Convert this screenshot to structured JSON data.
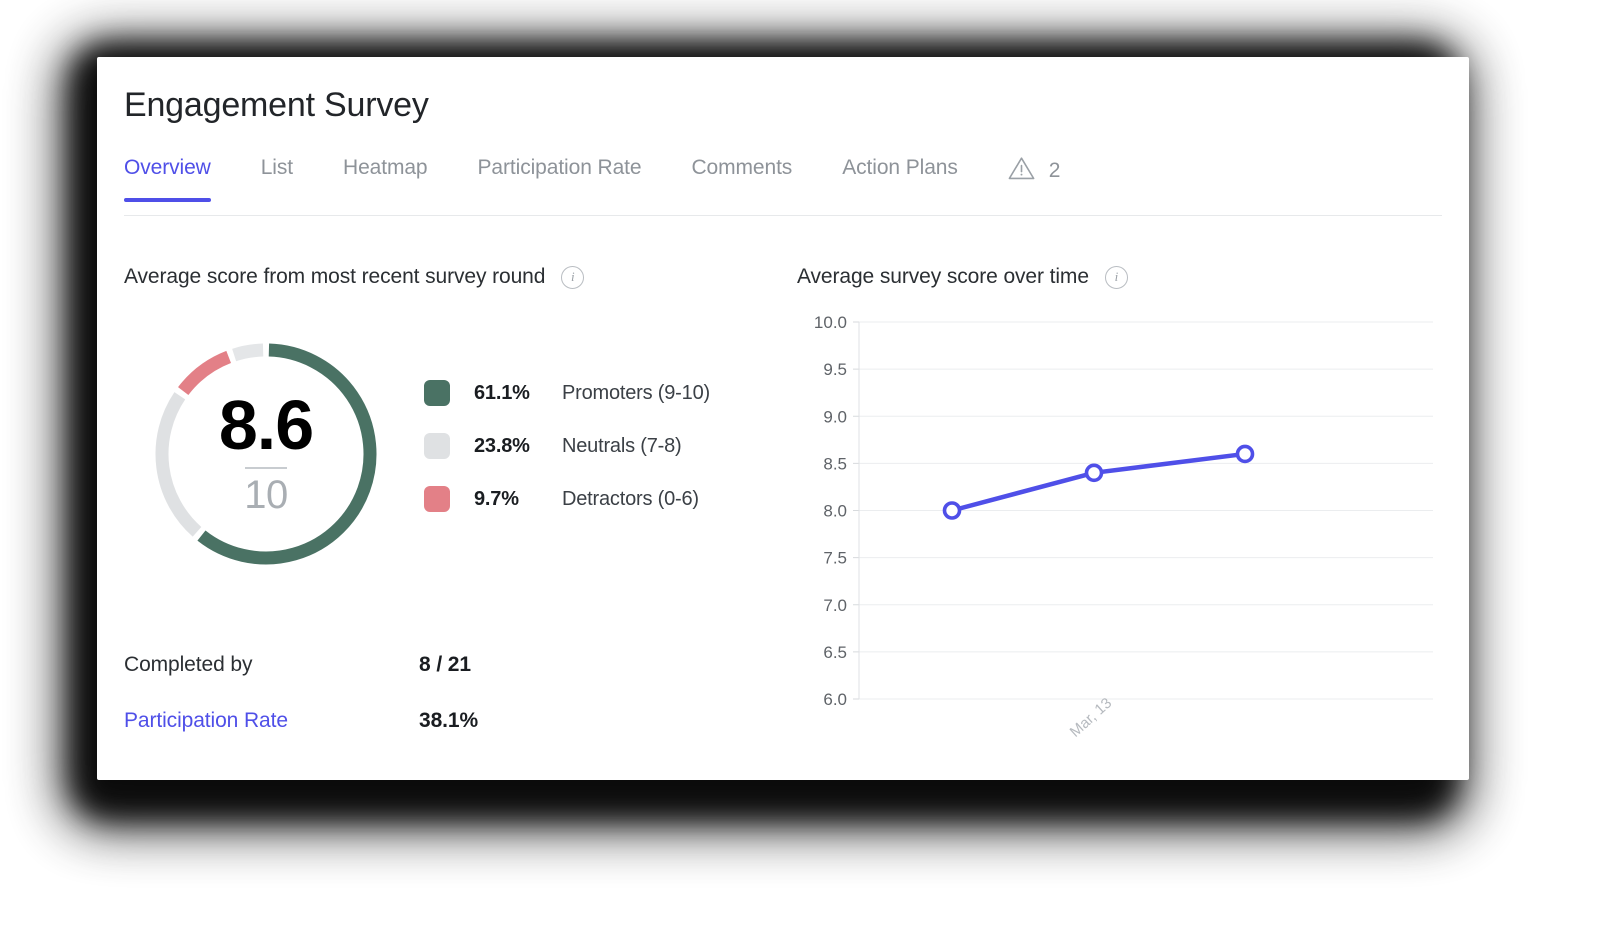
{
  "header": {
    "title": "Engagement Survey"
  },
  "tabs": [
    {
      "label": "Overview",
      "active": true
    },
    {
      "label": "List",
      "active": false
    },
    {
      "label": "Heatmap",
      "active": false
    },
    {
      "label": "Participation Rate",
      "active": false
    },
    {
      "label": "Comments",
      "active": false
    },
    {
      "label": "Action Plans",
      "active": false
    }
  ],
  "alert": {
    "icon": "warning-triangle-icon",
    "count": "2"
  },
  "score_panel": {
    "title": "Average score from most recent survey round",
    "info_icon": "info-icon",
    "score": "8.6",
    "max": "10",
    "legend": [
      {
        "percent": "61.1%",
        "label": "Promoters (9-10)",
        "color": "#4a7264"
      },
      {
        "percent": "23.8%",
        "label": "Neutrals (7-8)",
        "color": "#dfe1e3"
      },
      {
        "percent": "9.7%",
        "label": "Detractors (0-6)",
        "color": "#e38087"
      }
    ],
    "stats": [
      {
        "label": "Completed by",
        "value": "8 / 21",
        "is_link": false
      },
      {
        "label": "Participation Rate",
        "value": "38.1%",
        "is_link": true
      }
    ]
  },
  "trend_panel": {
    "title": "Average survey score over time",
    "info_icon": "info-icon"
  },
  "colors": {
    "accent": "#4f4fe8",
    "promoters": "#4a7264",
    "neutrals": "#dfe1e3",
    "detractors": "#e38087",
    "text": "#2b2f33",
    "muted": "#8e9399",
    "grid": "#ebedef"
  },
  "chart_data": [
    {
      "type": "pie",
      "title": "Average score from most recent survey round",
      "subtitle": "8.6 / 10",
      "legend_position": "right",
      "categories": [
        "Promoters (9-10)",
        "Neutrals (7-8)",
        "Detractors (0-6)"
      ],
      "values": [
        61.1,
        23.8,
        9.7
      ],
      "colors": [
        "#4a7264",
        "#dfe1e3",
        "#e38087"
      ],
      "center_value": 8.6,
      "center_max": 10,
      "note": "donut gauge; arcs drawn clockwise from 12 o'clock"
    },
    {
      "type": "line",
      "title": "Average survey score over time",
      "xlabel": "",
      "ylabel": "",
      "ylim": [
        6.0,
        10.0
      ],
      "ytick_labels": [
        "10.0",
        "9.5",
        "9.0",
        "8.5",
        "8.0",
        "7.5",
        "7.0",
        "6.5",
        "6.0"
      ],
      "ytick_values": [
        10.0,
        9.5,
        9.0,
        8.5,
        8.0,
        7.5,
        7.0,
        6.5,
        6.0
      ],
      "xtick_labels": [
        "Mar, 13"
      ],
      "grid": true,
      "series": [
        {
          "name": "Average survey score",
          "color": "#4f4fe8",
          "x": [
            0,
            1,
            2
          ],
          "values": [
            8.0,
            8.4,
            8.6
          ],
          "marker": "open-circle"
        }
      ]
    }
  ]
}
